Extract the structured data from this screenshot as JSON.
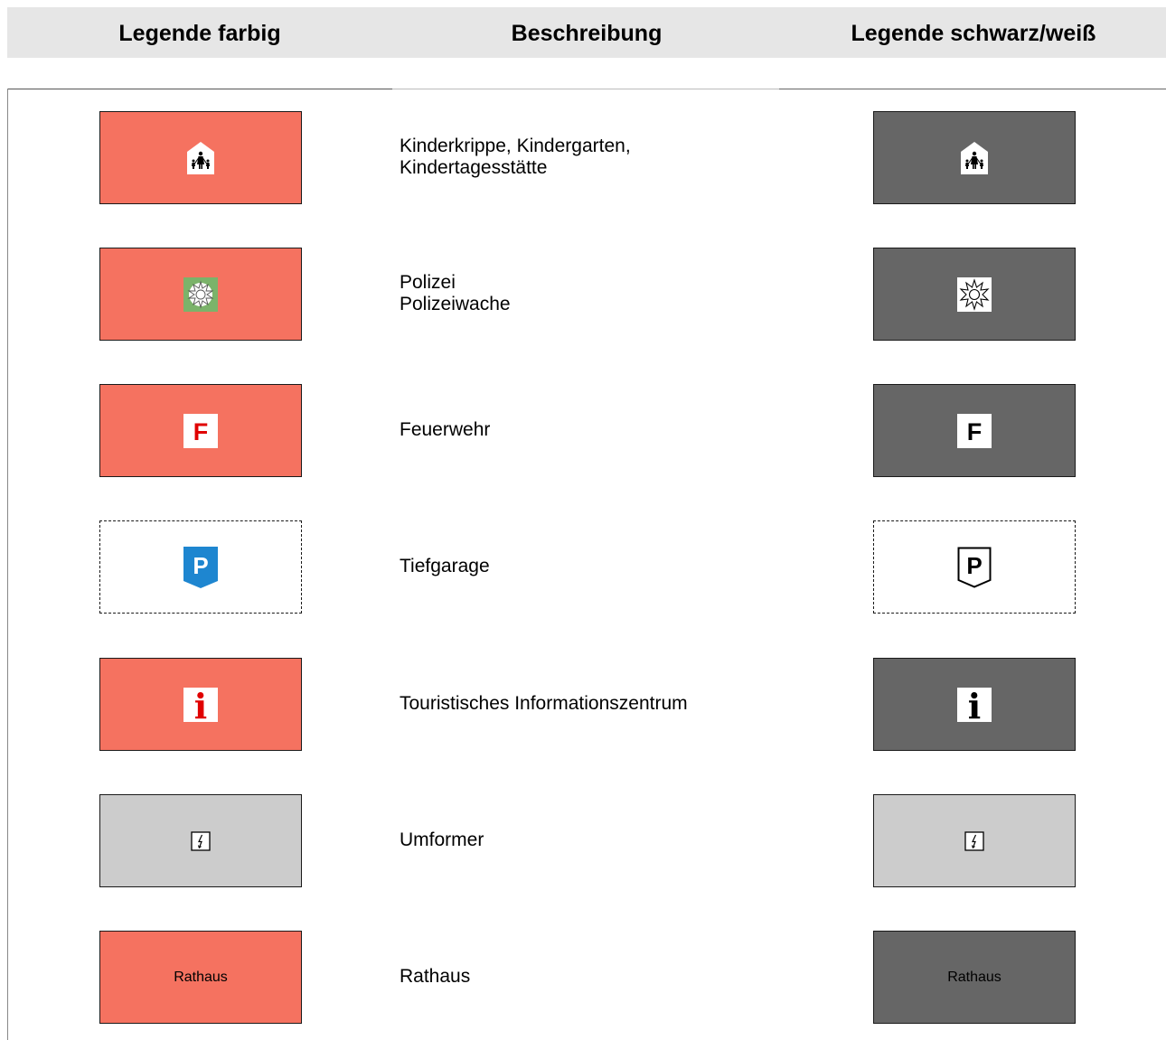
{
  "header": {
    "col_color": "Legende farbig",
    "col_description": "Beschreibung",
    "col_bw": "Legende schwarz/weiß"
  },
  "rows": [
    {
      "icon": "kindergarten-icon",
      "line1": "Kinderkrippe, Kindergarten,",
      "line2": "Kindertagesstätte",
      "color_fill": "#f57260",
      "bw_fill": "#666666"
    },
    {
      "icon": "police-star-icon",
      "line1": "Polizei",
      "line2": "Polizeiwache",
      "color_fill": "#f57260",
      "bw_fill": "#666666"
    },
    {
      "icon": "fire-station-icon",
      "icon_text": "F",
      "line1": "Feuerwehr",
      "color_fill": "#f57260",
      "bw_fill": "#666666"
    },
    {
      "icon": "underground-parking-icon",
      "icon_text": "P",
      "line1": "Tiefgarage",
      "color_fill": "#ffffff",
      "bw_fill": "#ffffff"
    },
    {
      "icon": "tourist-info-icon",
      "icon_text": "i",
      "line1": "Touristisches Informationszentrum",
      "color_fill": "#f57260",
      "bw_fill": "#666666"
    },
    {
      "icon": "transformer-icon",
      "line1": "Umformer",
      "color_fill": "#cccccc",
      "bw_fill": "#cccccc"
    },
    {
      "icon": "none",
      "label_color": "Rathaus",
      "label_bw": "Rathaus",
      "line1": "Rathaus",
      "color_fill": "#f57260",
      "bw_fill": "#666666"
    }
  ]
}
